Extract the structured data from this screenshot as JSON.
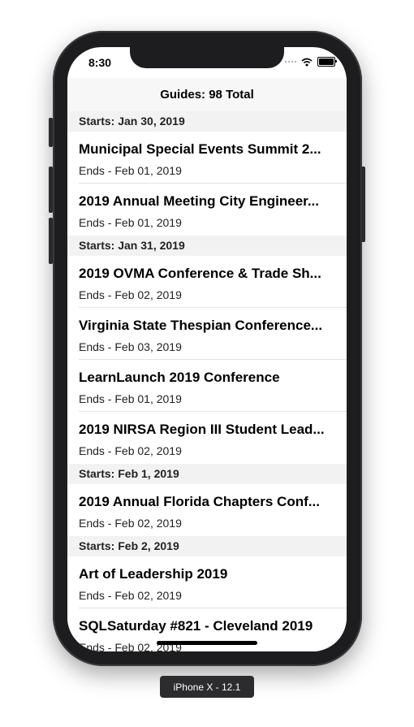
{
  "status_bar": {
    "time": "8:30"
  },
  "nav": {
    "title": "Guides: 98 Total"
  },
  "sections": [
    {
      "header": "Starts: Jan 30, 2019",
      "rows": [
        {
          "title": "Municipal Special Events Summit 2...",
          "subtitle": "Ends - Feb 01, 2019"
        },
        {
          "title": "2019 Annual Meeting City Engineer...",
          "subtitle": "Ends - Feb 01, 2019"
        }
      ]
    },
    {
      "header": "Starts: Jan 31, 2019",
      "rows": [
        {
          "title": "2019 OVMA Conference & Trade Sh...",
          "subtitle": "Ends - Feb 02, 2019"
        },
        {
          "title": "Virginia State Thespian Conference...",
          "subtitle": "Ends - Feb 03, 2019"
        },
        {
          "title": "LearnLaunch 2019 Conference",
          "subtitle": "Ends - Feb 01, 2019"
        },
        {
          "title": "2019 NIRSA Region III Student Lead...",
          "subtitle": "Ends - Feb 02, 2019"
        }
      ]
    },
    {
      "header": "Starts: Feb 1, 2019",
      "rows": [
        {
          "title": "2019 Annual Florida Chapters Conf...",
          "subtitle": "Ends - Feb 02, 2019"
        }
      ]
    },
    {
      "header": "Starts: Feb 2, 2019",
      "rows": [
        {
          "title": "Art of Leadership 2019",
          "subtitle": "Ends - Feb 02, 2019"
        },
        {
          "title": "SQLSaturday #821 - Cleveland 2019",
          "subtitle": "Ends - Feb 02, 2019"
        }
      ]
    }
  ],
  "device": {
    "label": "iPhone X - 12.1"
  }
}
